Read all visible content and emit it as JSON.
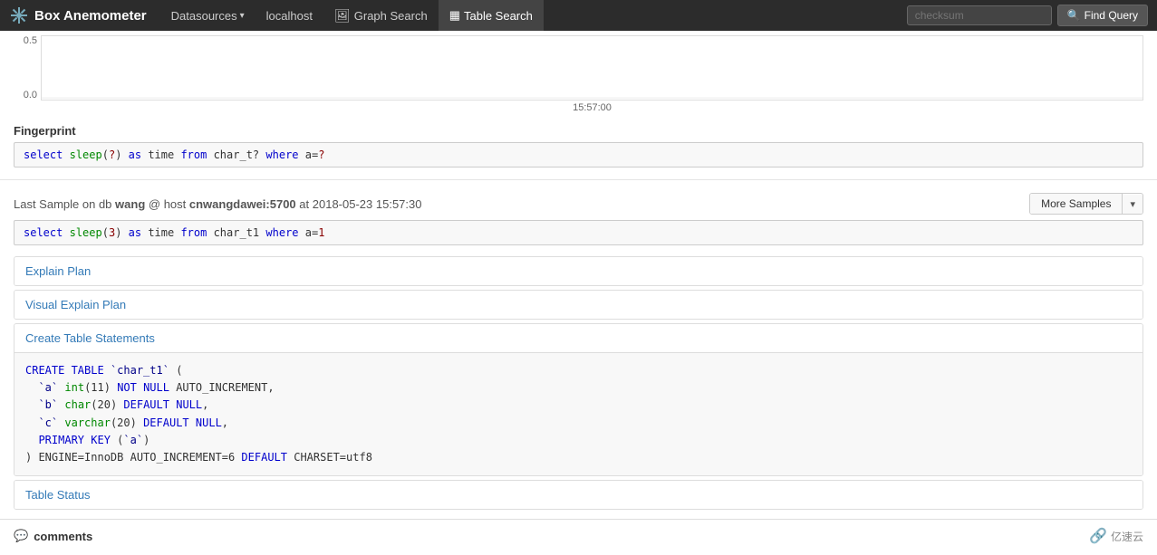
{
  "navbar": {
    "brand": "Box Anemometer",
    "nav_items": [
      {
        "label": "Datasources",
        "has_dropdown": true,
        "active": false
      },
      {
        "label": "localhost",
        "has_dropdown": false,
        "active": false
      },
      {
        "label": "Graph Search",
        "has_icon": true,
        "active": false
      },
      {
        "label": "Table Search",
        "has_icon": true,
        "active": true
      }
    ],
    "search_placeholder": "checksum",
    "find_button": "Find Query"
  },
  "chart": {
    "y_top": "0.5",
    "y_bottom": "0.0",
    "x_label": "15:57:00"
  },
  "fingerprint": {
    "label": "Fingerprint",
    "code": "select sleep(?) as time from char_t? where a=?"
  },
  "last_sample": {
    "prefix": "Last Sample on db",
    "db": "wang",
    "at_host": "@ host",
    "host": "cnwangdawei:5700",
    "at": "at",
    "date": "2018-05-23 15:57:30",
    "more_samples_label": "More Samples",
    "code": "select sleep(3) as time from char_t1 where a=1"
  },
  "sections": [
    {
      "id": "explain_plan",
      "title": "Explain Plan",
      "expanded": false
    },
    {
      "id": "visual_explain_plan",
      "title": "Visual Explain Plan",
      "expanded": false
    },
    {
      "id": "create_table",
      "title": "Create Table Statements",
      "expanded": true,
      "code_lines": [
        "CREATE TABLE `char_t1` (",
        "  `a` int(11) NOT NULL AUTO_INCREMENT,",
        "  `b` char(20) DEFAULT NULL,",
        "  `c` varchar(20) DEFAULT NULL,",
        "  PRIMARY KEY (`a`)",
        ") ENGINE=InnoDB AUTO_INCREMENT=6 DEFAULT CHARSET=utf8"
      ]
    },
    {
      "id": "table_status",
      "title": "Table Status",
      "expanded": false
    }
  ],
  "comments": {
    "icon": "💬",
    "title": "comments"
  },
  "footer_brand": "亿速云"
}
